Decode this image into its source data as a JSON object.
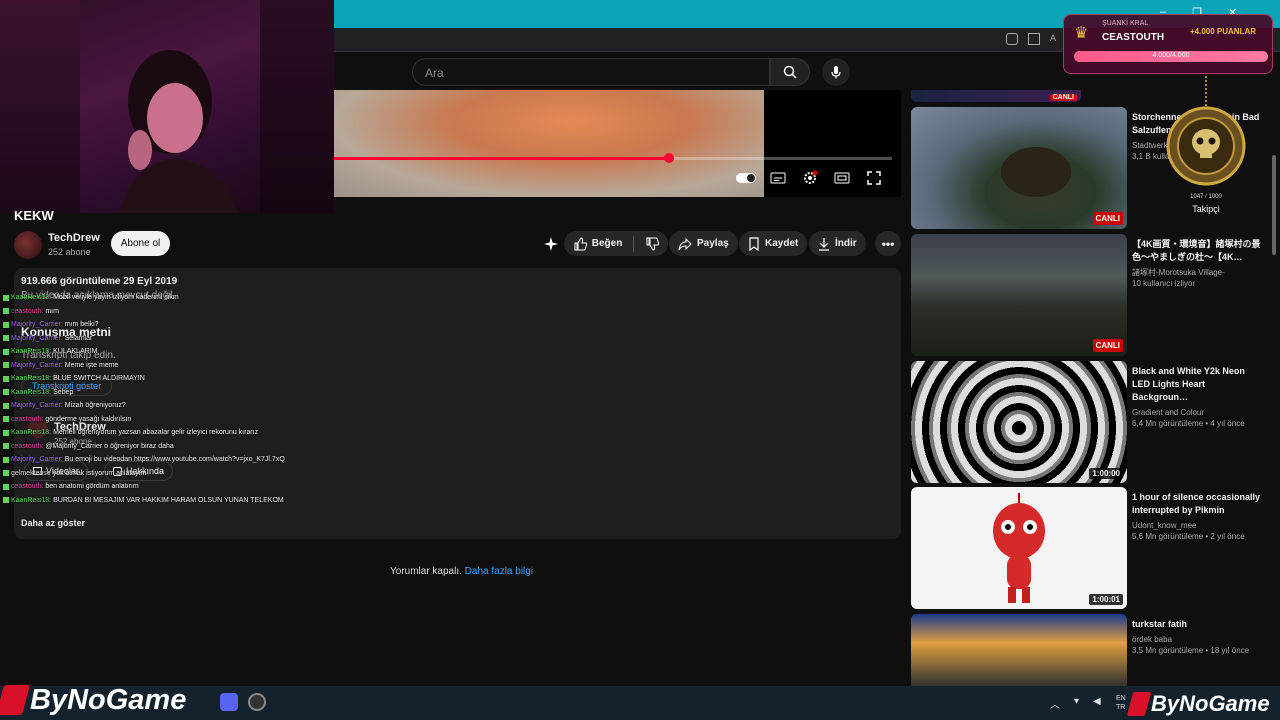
{
  "browser": {
    "window_controls": [
      "–",
      "❐",
      "✕"
    ]
  },
  "header": {
    "search_placeholder": "Ara"
  },
  "video": {
    "title": "KEKW",
    "channel": "TechDrew",
    "subscribers": "252 abone",
    "subscribe_label": "Abone ol",
    "progress_fraction": 0.6,
    "actions": {
      "like": "Beğen",
      "share": "Paylaş",
      "save": "Kaydet",
      "download": "İndir"
    }
  },
  "description": {
    "stats": "919.666 görüntüleme  29 Eyl 2019",
    "no_desc": "Bu videoda açıklama mevcut değil.",
    "transcript_heading": "Konuşma metni",
    "transcript_hint": "Transkripti takip edin.",
    "show_transcript": "Transkripti göster",
    "channel_name": "TechDrew",
    "channel_subs": "252 abone",
    "videos_label": "Videolar",
    "about_label": "Hakkında",
    "show_less": "Daha az göster"
  },
  "comments": {
    "off_text": "Yorumlar kapalı.",
    "learn_more": "Daha fazla bilgi"
  },
  "chat": [
    {
      "user": "KaanReis18:",
      "msg": "Mobil veriyle yayın izliyom kaderimi sikm",
      "color": "#5fd35f"
    },
    {
      "user": "ceastouth:",
      "msg": "mım",
      "color": "#e040a0"
    },
    {
      "user": "Majority_Carrier:",
      "msg": "mım belki?",
      "color": "#9b6bff"
    },
    {
      "user": "Majority_Carrier:",
      "msg": "Selamlar",
      "color": "#9b6bff"
    },
    {
      "user": "KaanReis18:",
      "msg": "KULAKLARIM",
      "color": "#5fd35f"
    },
    {
      "user": "Majority_Carrier:",
      "msg": "Meme işte meme",
      "color": "#9b6bff"
    },
    {
      "user": "KaanReis18:",
      "msg": "BLUE SWITCH ALDIRMAYIN",
      "color": "#5fd35f"
    },
    {
      "user": "KaanReis18:",
      "msg": "Sebep",
      "color": "#5fd35f"
    },
    {
      "user": "Majority_Carrier:",
      "msg": "Mizah öğreniyoruz?",
      "color": "#9b6bff"
    },
    {
      "user": "ceastouth:",
      "msg": "gönderme yasağı kaldırılsın",
      "color": "#e040a0"
    },
    {
      "user": "KaanReis18:",
      "msg": "Memeli öğreniyorum yazsan abazalar gelir izleyici rekorunu kırarız",
      "color": "#5fd35f"
    },
    {
      "user": "ceastouth:",
      "msg": "@Majority_Carrier o öğreniyor biraz daha",
      "color": "#e040a0"
    },
    {
      "user": "Majority_Carrier:",
      "msg": "Bu emoji bu videodan https://www.youtube.com/watch?v=jxo_K7Jl.7xQ",
      "color": "#9b6bff"
    },
    {
      "user": "gelmektense",
      "msg": "yok olmak istiyorum anlatayım",
      "color": "#dddddd"
    },
    {
      "user": "ceastouth:",
      "msg": "ben anatomi gördüm anlatırım",
      "color": "#e040a0"
    },
    {
      "user": "KaanReis18:",
      "msg": "BURDAN BI MESAJIM VAR HAKKIM HARAM OLSUN YUNAN TELEKOM",
      "color": "#5fd35f"
    }
  ],
  "recommendations": [
    {
      "title": "Storchennest-Webcam in Bad Salzuflen",
      "meta1": "Stadtwerke",
      "meta2": "3,1 B kullanıcı izliyor",
      "badge": "CANLI",
      "badge_type": "live"
    },
    {
      "title": "【4K画質・環境音】諸塚村の景色～やましぎの杜～【4K…",
      "meta1": "諸塚村-Morotsuka Village-",
      "meta2": "10 kullanıcı izliyor",
      "badge": "CANLI",
      "badge_type": "live"
    },
    {
      "title": "Black and White Y2k Neon LED Lights Heart Backgroun…",
      "meta1": "Gradient and Colour",
      "meta2": "6,4 Mn görüntüleme • 4 yıl önce",
      "badge": "1:00:00",
      "badge_type": "duration"
    },
    {
      "title": "1 hour of silence occasionally interrupted by Pikmin",
      "meta1": "Udont_know_mee",
      "meta2": "5,6 Mn görüntüleme • 2 yıl önce",
      "badge": "1:00:01",
      "badge_type": "duration"
    },
    {
      "title": "turkstar fatih",
      "meta1": "ördek baba",
      "meta2": "3,5 Mn görüntüleme • 18 yıl önce",
      "badge": "",
      "badge_type": "none"
    }
  ],
  "top_live_badge": "CANLI",
  "king_widget": {
    "label": "ŞUANKİ KRAL",
    "name": "CEASTOUTH",
    "points": "+4.000 PUANLAR",
    "bar_text": "4.000/4.000",
    "bar_fraction": 1.0
  },
  "follower_widget": {
    "count": "1047 / 1000",
    "label": "Takipçi"
  },
  "branding": {
    "logo_text": "ByNoGame"
  },
  "taskbar": {
    "lang1": "EN",
    "lang2": "TR"
  }
}
